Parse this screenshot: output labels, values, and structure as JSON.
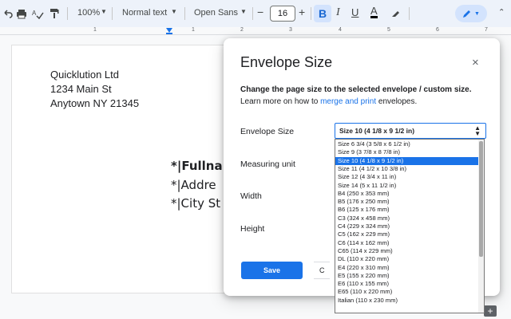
{
  "toolbar": {
    "zoom": "100%",
    "style": "Normal text",
    "font": "Open Sans",
    "font_size": "16",
    "minus": "−",
    "plus": "+",
    "bold": "B",
    "italic": "I",
    "underline": "U",
    "text_color": "A"
  },
  "ruler": {
    "marks": [
      "1",
      "1",
      "2",
      "3",
      "4",
      "5",
      "6",
      "7"
    ]
  },
  "document": {
    "address": [
      "Quicklution Ltd",
      "1234 Main St",
      "Anytown NY 21345"
    ],
    "merge_fields": [
      "*|Fullna",
      "*|Addre",
      "*|City St"
    ]
  },
  "dialog": {
    "title": "Envelope Size",
    "close": "×",
    "description": "Change the page size to the selected envelope / custom size.",
    "learn_prefix": "Learn more on how to ",
    "learn_link": "merge and print",
    "learn_suffix": " envelopes.",
    "labels": {
      "envelope_size": "Envelope Size",
      "measuring_unit": "Measuring unit",
      "width": "Width",
      "height": "Height"
    },
    "selected_size": "Size 10 (4 1/8 x 9 1/2 in)",
    "save": "Save",
    "cancel_partial": "C"
  },
  "dropdown": {
    "selected_index": 2,
    "options": [
      "Size 6 3/4 (3 5/8 x 6 1/2 in)",
      "Size 9 (3 7/8 x 8 7/8 in)",
      "Size 10 (4 1/8 x 9 1/2 in)",
      "Size 11 (4 1/2 x 10 3/8 in)",
      "Size 12 (4 3/4 x 11 in)",
      "Size 14 (5 x 11 1/2 in)",
      "B4 (250 x 353 mm)",
      "B5 (176 x 250 mm)",
      "B6 (125 x 176 mm)",
      "C3 (324 x 458 mm)",
      "C4 (229 x 324 mm)",
      "C5 (162 x 229 mm)",
      "C6 (114 x 162 mm)",
      "C65 (114 x 229 mm)",
      "DL (110 x 220 mm)",
      "E4 (220 x 310 mm)",
      "E5 (155 x 220 mm)",
      "E6 (110 x 155 mm)",
      "E65 (110 x 220 mm)",
      "Italian (110 x 230 mm)"
    ]
  },
  "colors": {
    "accent": "#1a73e8",
    "toolbar_bg": "#edf2fa",
    "selected_bg": "#d3e3fd"
  },
  "icons": [
    "undo-icon",
    "print-icon",
    "spellcheck-icon",
    "paint-format-icon",
    "highlighter-icon",
    "edit-pen-icon",
    "close-icon",
    "expand-icon"
  ]
}
